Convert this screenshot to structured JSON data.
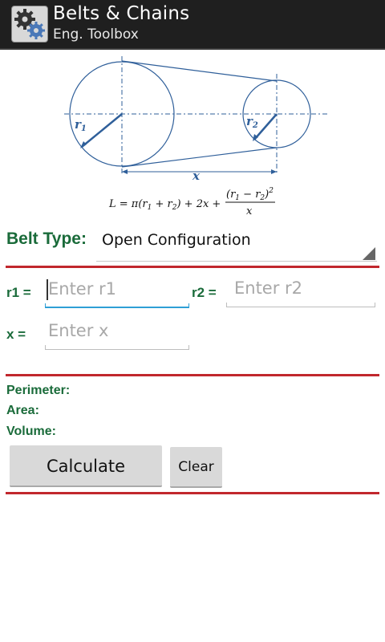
{
  "app": {
    "title": "Belts & Chains",
    "subtitle": "Eng. Toolbox",
    "icon": "gears-icon"
  },
  "diagram": {
    "r1_label": "r",
    "r1_sub": "1",
    "r2_label": "r",
    "r2_sub": "2",
    "x_label": "x",
    "formula_lhs": "L = π(r",
    "formula_mid": " + r",
    "formula_tail": ") + 2x +",
    "formula_num": "(r",
    "formula_num_mid": " − r",
    "formula_num_tail": ")",
    "formula_exp": "2",
    "formula_den": "x",
    "sub1": "1",
    "sub2": "2"
  },
  "belt": {
    "label": "Belt Type:",
    "selected": "Open Configuration"
  },
  "inputs": {
    "r1_label": "r1 =",
    "r1_placeholder": "Enter r1",
    "r2_label": "r2 =",
    "r2_placeholder": "Enter r2",
    "x_label": "x =",
    "x_placeholder": "Enter x"
  },
  "results": {
    "perimeter": "Perimeter:",
    "area": "Area:",
    "volume": "Volume:"
  },
  "buttons": {
    "calculate": "Calculate",
    "clear": "Clear"
  },
  "colors": {
    "label_green": "#1a6b3a",
    "divider_red": "#c1272d",
    "focus_blue": "#2e9fd6",
    "diagram_blue": "#2f5f9a"
  }
}
